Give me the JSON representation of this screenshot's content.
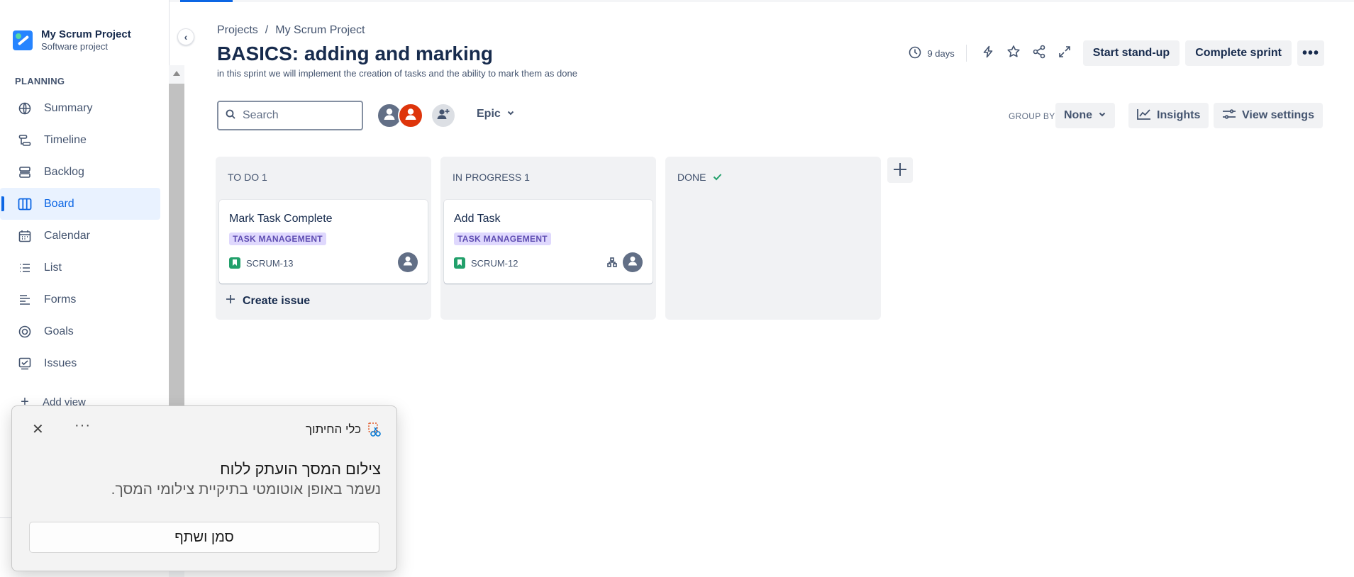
{
  "project": {
    "name": "My Scrum Project",
    "type": "Software project"
  },
  "sidebar": {
    "section_label": "PLANNING",
    "items": [
      {
        "label": "Summary",
        "icon": "globe-icon",
        "active": false
      },
      {
        "label": "Timeline",
        "icon": "timeline-icon",
        "active": false
      },
      {
        "label": "Backlog",
        "icon": "backlog-icon",
        "active": false
      },
      {
        "label": "Board",
        "icon": "board-icon",
        "active": true
      },
      {
        "label": "Calendar",
        "icon": "calendar-icon",
        "active": false
      },
      {
        "label": "List",
        "icon": "list-icon",
        "active": false
      },
      {
        "label": "Forms",
        "icon": "forms-icon",
        "active": false
      },
      {
        "label": "Goals",
        "icon": "goals-icon",
        "active": false
      },
      {
        "label": "Issues",
        "icon": "issues-icon",
        "active": false
      }
    ],
    "add_view_label": "Add view"
  },
  "breadcrumb": {
    "root": "Projects",
    "separator": "/",
    "current": "My Scrum Project"
  },
  "header": {
    "title": "BASICS: adding and marking",
    "goal": "in this sprint we will implement the creation of tasks and the ability to mark them as done",
    "days_remaining": "9 days",
    "start_standup_label": "Start stand-up",
    "complete_sprint_label": "Complete sprint",
    "more_label": "•••"
  },
  "toolbar": {
    "search_placeholder": "Search",
    "epic_label": "Epic",
    "group_by_label": "GROUP BY",
    "group_by_value": "None",
    "insights_label": "Insights",
    "view_settings_label": "View settings"
  },
  "board": {
    "columns": [
      {
        "title": "TO DO 1",
        "cards": [
          {
            "title": "Mark Task Complete",
            "epic": "TASK MANAGEMENT",
            "key": "SCRUM-13",
            "has_children": false
          }
        ],
        "create_issue_label": "Create issue"
      },
      {
        "title": "IN PROGRESS 1",
        "cards": [
          {
            "title": "Add Task",
            "epic": "TASK MANAGEMENT",
            "key": "SCRUM-12",
            "has_children": true
          }
        ]
      },
      {
        "title": "DONE",
        "done_check": true,
        "cards": []
      }
    ]
  },
  "toast": {
    "app_name": "כלי החיתוך",
    "title": "צילום המסך הועתק ללוח",
    "subtitle": "נשמר באופן אוטומטי בתיקיית צילומי המסך.",
    "action_label": "סמן ושתף",
    "close_label": "✕",
    "more_label": "···"
  },
  "colors": {
    "accent": "#0c66e4",
    "epic_lozenge_bg": "#dfd8fd",
    "epic_lozenge_text": "#5e4db2",
    "story": "#22a06b",
    "done_check": "#22a06b"
  }
}
